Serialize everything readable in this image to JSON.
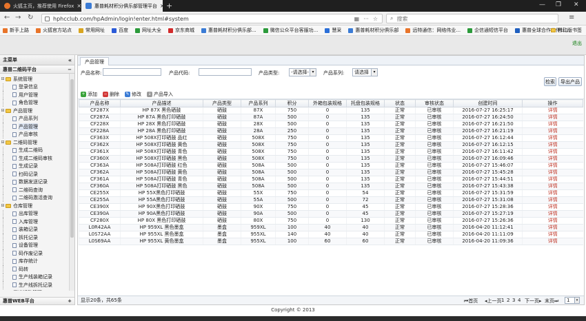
{
  "browser": {
    "tabs": [
      {
        "title": "火狐主页，推荐使用 Firefox",
        "close": "×"
      },
      {
        "title": "惠普耗材积分俱乐部管理平台",
        "close": "×"
      }
    ],
    "new_tab": "+",
    "window_controls": [
      "—",
      "❐",
      "✕"
    ],
    "url": "hphcclub.com/hpAdmin/login!enter.html#system",
    "url_host_part": "hphcclub.com",
    "search_placeholder": "搜索",
    "bookmarks": [
      {
        "label": "新手上路",
        "color": "#e8742a"
      },
      {
        "label": "火狐官方站点",
        "color": "#e8742a"
      },
      {
        "label": "常用网址",
        "color": "#d9a520"
      },
      {
        "label": "百度",
        "color": "#2b5bd8"
      },
      {
        "label": "网址大全",
        "color": "#2b9a3a"
      },
      {
        "label": "京东商城",
        "color": "#d22b2b"
      },
      {
        "label": "惠普耗材积分俱乐部...",
        "color": "#3a7bd5"
      },
      {
        "label": "微信公众平台客服功...",
        "color": "#2b9a3a"
      },
      {
        "label": "慧采",
        "color": "#2b6fd8"
      },
      {
        "label": "惠普耗材积分俱乐部",
        "color": "#3a7bd5"
      },
      {
        "label": "远特通信：网络伟业...",
        "color": "#e8742a"
      },
      {
        "label": "企信通短信平台",
        "color": "#2b9a3a"
      },
      {
        "label": "惠普全球合作伙伴计...",
        "color": "#1f5fbf"
      }
    ],
    "mobile_bookmarks": "移动版书签"
  },
  "app": {
    "logout": "退出",
    "sidebar": {
      "title": "主菜单",
      "collapse_icon": "«",
      "group_top": "惠普二维码平台",
      "group_top_toggle": "−",
      "tree": [
        {
          "level": 0,
          "type": "folder",
          "label": "系统管理"
        },
        {
          "level": 1,
          "type": "doc",
          "label": "登录信息"
        },
        {
          "level": 1,
          "type": "doc",
          "label": "用户管理"
        },
        {
          "level": 1,
          "type": "doc",
          "label": "角色管理"
        },
        {
          "level": 0,
          "type": "folder",
          "label": "产品管理"
        },
        {
          "level": 1,
          "type": "doc",
          "label": "产品系列"
        },
        {
          "level": 1,
          "type": "doc",
          "label": "产品管理",
          "selected": true
        },
        {
          "level": 1,
          "type": "doc",
          "label": "产品审核"
        },
        {
          "level": 0,
          "type": "folder",
          "label": "二维码管理"
        },
        {
          "level": 1,
          "type": "doc",
          "label": "生成二维码"
        },
        {
          "level": 1,
          "type": "doc",
          "label": "生成二维码审核"
        },
        {
          "level": 1,
          "type": "doc",
          "label": "生成记录"
        },
        {
          "level": 1,
          "type": "doc",
          "label": "扫码记录"
        },
        {
          "level": 1,
          "type": "doc",
          "label": "数据发送记录"
        },
        {
          "level": 1,
          "type": "doc",
          "label": "二维码查询"
        },
        {
          "level": 1,
          "type": "doc",
          "label": "二维码激活查询"
        },
        {
          "level": 0,
          "type": "folder",
          "label": "仓库管理"
        },
        {
          "level": 1,
          "type": "doc",
          "label": "出库管理"
        },
        {
          "level": 1,
          "type": "doc",
          "label": "入库管理"
        },
        {
          "level": 1,
          "type": "doc",
          "label": "装箱记录"
        },
        {
          "level": 1,
          "type": "doc",
          "label": "拆托记录"
        },
        {
          "level": 1,
          "type": "doc",
          "label": "设备管理"
        },
        {
          "level": 1,
          "type": "doc",
          "label": "码作废记录"
        },
        {
          "level": 1,
          "type": "doc",
          "label": "库存统计"
        },
        {
          "level": 1,
          "type": "doc",
          "label": "码转"
        },
        {
          "level": 1,
          "type": "doc",
          "label": "生产线装箱记录"
        },
        {
          "level": 1,
          "type": "doc",
          "label": "生产线拆托记录"
        },
        {
          "level": 0,
          "type": "folder",
          "label": "渠道活动管理"
        }
      ],
      "group_bottom": "惠普WEB平台",
      "group_bottom_toggle": "+"
    },
    "main": {
      "tab": "产品管理",
      "form": {
        "name_label": "产品名称:",
        "code_label": "产品代码:",
        "type_label": "产品类型:",
        "type_value": "-请选择-",
        "series_label": "产品系列:",
        "series_value": "请选择",
        "search_button": "检索",
        "export_button": "导出产品"
      },
      "toolbar": [
        {
          "label": "添加",
          "icon": "add-icon",
          "glyph": "+",
          "color": "#3aa33a"
        },
        {
          "label": "删除",
          "icon": "delete-icon",
          "glyph": "−",
          "color": "#d23a3a"
        },
        {
          "label": "修改",
          "icon": "edit-icon",
          "glyph": "✎",
          "color": "#3a7bd5"
        },
        {
          "label": "产品导入",
          "icon": "import-icon",
          "glyph": "↓",
          "color": "#9a9a9a"
        }
      ],
      "table": {
        "columns": [
          "产品名称",
          "产品描述",
          "产品类型",
          "产品系列",
          "积分",
          "外箱包装规格",
          "托盘包装规格",
          "状态",
          "审核状态",
          "创建时间",
          "操作"
        ],
        "rows": [
          [
            "CF287X",
            "HP 87X 黑色硒鼓",
            "硒鼓",
            "87X",
            "750",
            "0",
            "135",
            "正常",
            "已审核",
            "2016-07-27 16:25:17",
            "详情"
          ],
          [
            "CF287A",
            "HP 87A 黑色打印硒鼓",
            "硒鼓",
            "87A",
            "500",
            "0",
            "135",
            "正常",
            "已审核",
            "2016-07-27 16:24:50",
            "详情"
          ],
          [
            "CF228X",
            "HP 28X 黑色打印硒鼓",
            "硒鼓",
            "28X",
            "500",
            "0",
            "135",
            "正常",
            "已审核",
            "2016-07-27 16:21:50",
            "详情"
          ],
          [
            "CF228A",
            "HP 28A 黑色打印硒鼓",
            "硒鼓",
            "28A",
            "250",
            "0",
            "135",
            "正常",
            "已审核",
            "2016-07-27 16:21:19",
            "详情"
          ],
          [
            "CF363X",
            "HP 508X打印硒鼓 品红",
            "硒鼓",
            "508X",
            "750",
            "0",
            "135",
            "正常",
            "已审核",
            "2016-07-27 16:12:44",
            "详情"
          ],
          [
            "CF362X",
            "HP 508X打印硒鼓 黄色",
            "硒鼓",
            "508X",
            "750",
            "0",
            "135",
            "正常",
            "已审核",
            "2016-07-27 16:12:15",
            "详情"
          ],
          [
            "CF361X",
            "HP 508X打印硒鼓 青色",
            "硒鼓",
            "508X",
            "750",
            "0",
            "135",
            "正常",
            "已审核",
            "2016-07-27 16:11:42",
            "详情"
          ],
          [
            "CF360X",
            "HP 508X打印硒鼓 黑色",
            "硒鼓",
            "508X",
            "750",
            "0",
            "135",
            "正常",
            "已审核",
            "2016-07-27 16:09:46",
            "详情"
          ],
          [
            "CF363A",
            "HP 508A打印硒鼓 红色",
            "硒鼓",
            "508A",
            "500",
            "0",
            "135",
            "正常",
            "已审核",
            "2016-07-27 15:46:07",
            "详情"
          ],
          [
            "CF362A",
            "HP 508A打印硒鼓 黄色",
            "硒鼓",
            "508A",
            "500",
            "0",
            "135",
            "正常",
            "已审核",
            "2016-07-27 15:45:28",
            "详情"
          ],
          [
            "CF361A",
            "HP 508A打印硒鼓 青色",
            "硒鼓",
            "508A",
            "500",
            "0",
            "135",
            "正常",
            "已审核",
            "2016-07-27 15:44:51",
            "详情"
          ],
          [
            "CF360A",
            "HP 508A打印硒鼓 黑色",
            "硒鼓",
            "508A",
            "500",
            "0",
            "135",
            "正常",
            "已审核",
            "2016-07-27 15:43:38",
            "详情"
          ],
          [
            "CE255X",
            "HP 55X黑色打印硒鼓",
            "硒鼓",
            "55X",
            "750",
            "0",
            "54",
            "正常",
            "已审核",
            "2016-07-27 15:31:59",
            "详情"
          ],
          [
            "CE255A",
            "HP 55A黑色打印硒鼓",
            "硒鼓",
            "55A",
            "500",
            "0",
            "72",
            "正常",
            "已审核",
            "2016-07-27 15:31:08",
            "详情"
          ],
          [
            "CE390X",
            "HP 90X黑色打印硒鼓",
            "硒鼓",
            "90X",
            "750",
            "0",
            "45",
            "正常",
            "已审核",
            "2016-07-27 15:28:36",
            "详情"
          ],
          [
            "CE390A",
            "HP 90A黑色打印硒鼓",
            "硒鼓",
            "90A",
            "500",
            "0",
            "45",
            "正常",
            "已审核",
            "2016-07-27 15:27:19",
            "详情"
          ],
          [
            "CF280X",
            "HP 80X 黑色打印硒鼓",
            "硒鼓",
            "80X",
            "750",
            "0",
            "130",
            "正常",
            "已审核",
            "2016-07-27 15:26:36",
            "详情"
          ],
          [
            "L0R42AA",
            "HP 959XL 黑色墨盒",
            "墨盒",
            "959XL",
            "100",
            "40",
            "40",
            "正常",
            "已审核",
            "2016-04-20 11:12:41",
            "详情"
          ],
          [
            "L0S72AA",
            "HP 955XL 黑色墨盒",
            "墨盒",
            "955XL",
            "140",
            "40",
            "40",
            "正常",
            "已审核",
            "2016-04-20 11:11:09",
            "详情"
          ],
          [
            "L0S69AA",
            "HP 955XL 黄色墨盒",
            "墨盒",
            "955XL",
            "100",
            "60",
            "60",
            "正常",
            "已审核",
            "2016-04-20 11:09:36",
            "详情"
          ]
        ]
      },
      "pager": {
        "summary": "显示20条，共65条",
        "first": "首页",
        "prev": "上一页",
        "pages": [
          "1",
          "2",
          "3",
          "4"
        ],
        "next": "下一页",
        "last": "末页",
        "current": "1"
      }
    },
    "footer": "Copyright © 2013"
  }
}
